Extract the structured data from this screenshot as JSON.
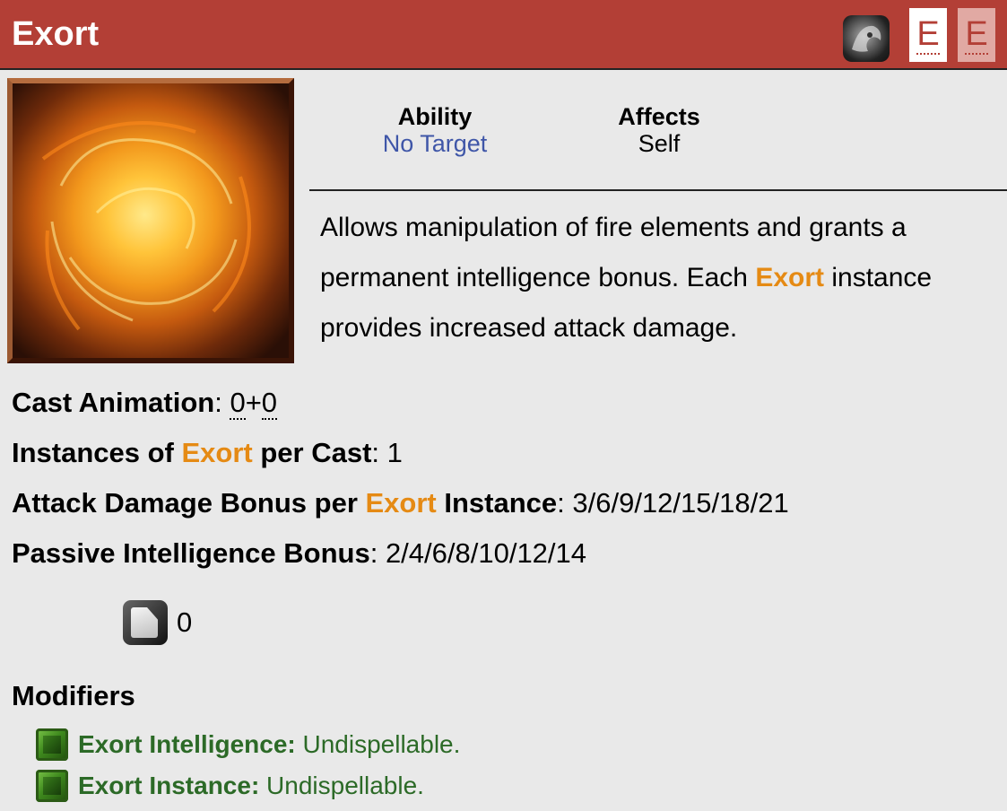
{
  "header": {
    "title": "Exort",
    "keys": [
      "E",
      "E"
    ]
  },
  "ability": {
    "label": "Ability",
    "value": "No Target"
  },
  "affects": {
    "label": "Affects",
    "value": "Self"
  },
  "description": {
    "part1": "Allows manipulation of fire elements and grants a permanent intelligence bonus. Each ",
    "highlight": "Exort",
    "part2": " instance provides increased attack damage."
  },
  "stats": {
    "cast_animation": {
      "label": "Cast Animation",
      "v1": "0",
      "plus": "+",
      "v2": "0"
    },
    "instances": {
      "pre": "Instances of ",
      "hl": "Exort",
      "post": " per Cast",
      "value": "1"
    },
    "attack_bonus": {
      "pre": "Attack Damage Bonus per ",
      "hl": "Exort",
      "post": " Instance",
      "value": "3/6/9/12/15/18/21"
    },
    "int_bonus": {
      "label": "Passive Intelligence Bonus",
      "value": "2/4/6/8/10/12/14"
    }
  },
  "mana": {
    "value": "0",
    "icon": "mana-cost-icon"
  },
  "modifiers": {
    "heading": "Modifiers",
    "items": [
      {
        "name": "Exort Intelligence:",
        "desc": " Undispellable.",
        "icon": "modifier-icon"
      },
      {
        "name": "Exort Instance:",
        "desc": " Undispellable.",
        "icon": "modifier-icon"
      }
    ]
  },
  "colors": {
    "header": "#b33f36",
    "orange": "#e58a14",
    "link_blue": "#3f56a8",
    "modifier_green": "#2c6a27"
  }
}
